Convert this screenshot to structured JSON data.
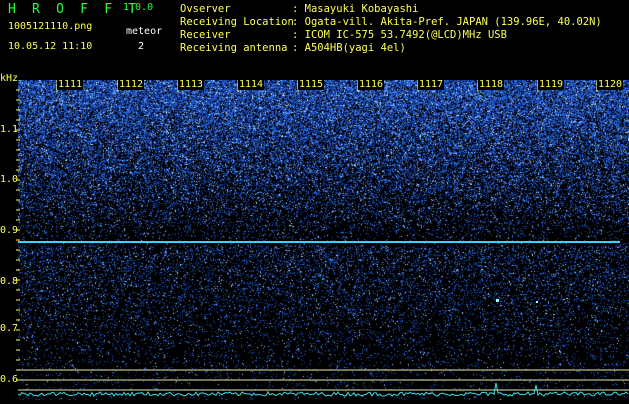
{
  "header": {
    "app_title": "H R O F F T",
    "version": "1.0.0",
    "file_name": "1005121110.png",
    "meteor_label": "meteor",
    "datetime": "10.05.12 11:10",
    "meteor_count": "2",
    "info": [
      {
        "label": "Ovserver",
        "value": ": Masayuki Kobayashi"
      },
      {
        "label": "Receiving Location",
        "value": ": Ogata-vill. Akita-Pref. JAPAN (139.96E, 40.02N)"
      },
      {
        "label": "Receiver",
        "value": ": ICOM IC-575 53.7492(@LCD)MHz USB"
      },
      {
        "label": "Receiving antenna",
        "value": ": A504HB(yagi 4el)"
      }
    ]
  },
  "spectrogram": {
    "y_unit": "kHz",
    "y_ticks": [
      "1.1",
      "1.0",
      "0.9",
      "0.8",
      "0.7",
      "0.6"
    ],
    "time_ticks": [
      "1111",
      "1112",
      "1113",
      "1114",
      "1115",
      "1116",
      "1117",
      "1118",
      "1119",
      "1120"
    ],
    "colors": {
      "background": "#000000",
      "noise": "#2b5cff",
      "carrier_line": "#34d6ff",
      "markers": "#ffff55",
      "trace": "#40e0e0"
    }
  }
}
